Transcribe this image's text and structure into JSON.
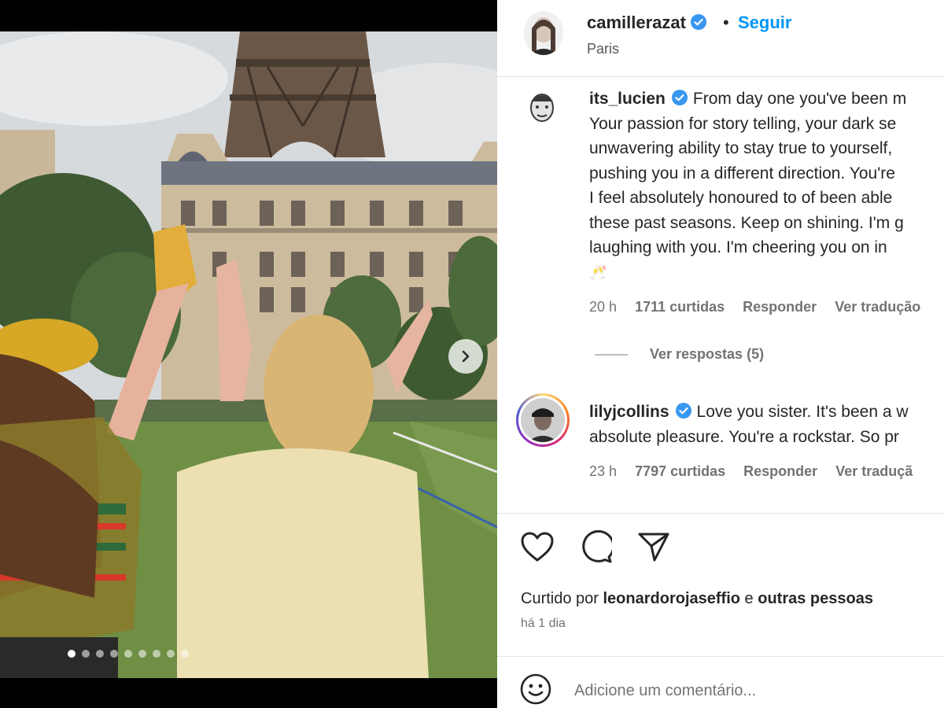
{
  "post": {
    "author": "camillerazat",
    "follow_label": "Seguir",
    "bullet": "•",
    "location": "Paris",
    "carousel": {
      "slides": 9,
      "current": 1
    }
  },
  "comments": [
    {
      "user": "its_lucien",
      "verified": true,
      "lines": [
        "From day one you've been m",
        "Your passion for story telling, your dark se",
        "unwavering ability to stay true to yourself,",
        "pushing you in a different direction. You're",
        "I feel absolutely honoured to of been able",
        "these past seasons. Keep on shining. I'm g",
        "laughing with you. I'm cheering you on in"
      ],
      "emoji": "🥂",
      "time": "20 h",
      "likes": "1711 curtidas",
      "reply_label": "Responder",
      "translate_label": "Ver tradução",
      "view_replies": "Ver respostas (5)"
    },
    {
      "user": "lilyjcollins",
      "verified": true,
      "lines": [
        "Love you sister. It's been a w",
        "absolute pleasure. You're a rockstar. So pr"
      ],
      "time": "23 h",
      "likes": "7797 curtidas",
      "reply_label": "Responder",
      "translate_label": "Ver traduçã"
    }
  ],
  "icons": {
    "like": "heart-icon",
    "comment": "comment-bubble-icon",
    "share": "paper-plane-icon",
    "emoji": "smiley-icon",
    "next": "chevron-right-icon",
    "verified": "verified-badge-icon"
  },
  "likes_summary": {
    "prefix": "Curtido por",
    "user": "leonardorojaseffio",
    "conj": "e",
    "others": "outras pessoas"
  },
  "posted_ago": "há 1 dia",
  "add_comment": {
    "placeholder": "Adicione um comentário..."
  },
  "colors": {
    "link_blue": "#0095f6",
    "verified_blue": "#3897f0",
    "text": "#262626",
    "muted": "#737373"
  }
}
